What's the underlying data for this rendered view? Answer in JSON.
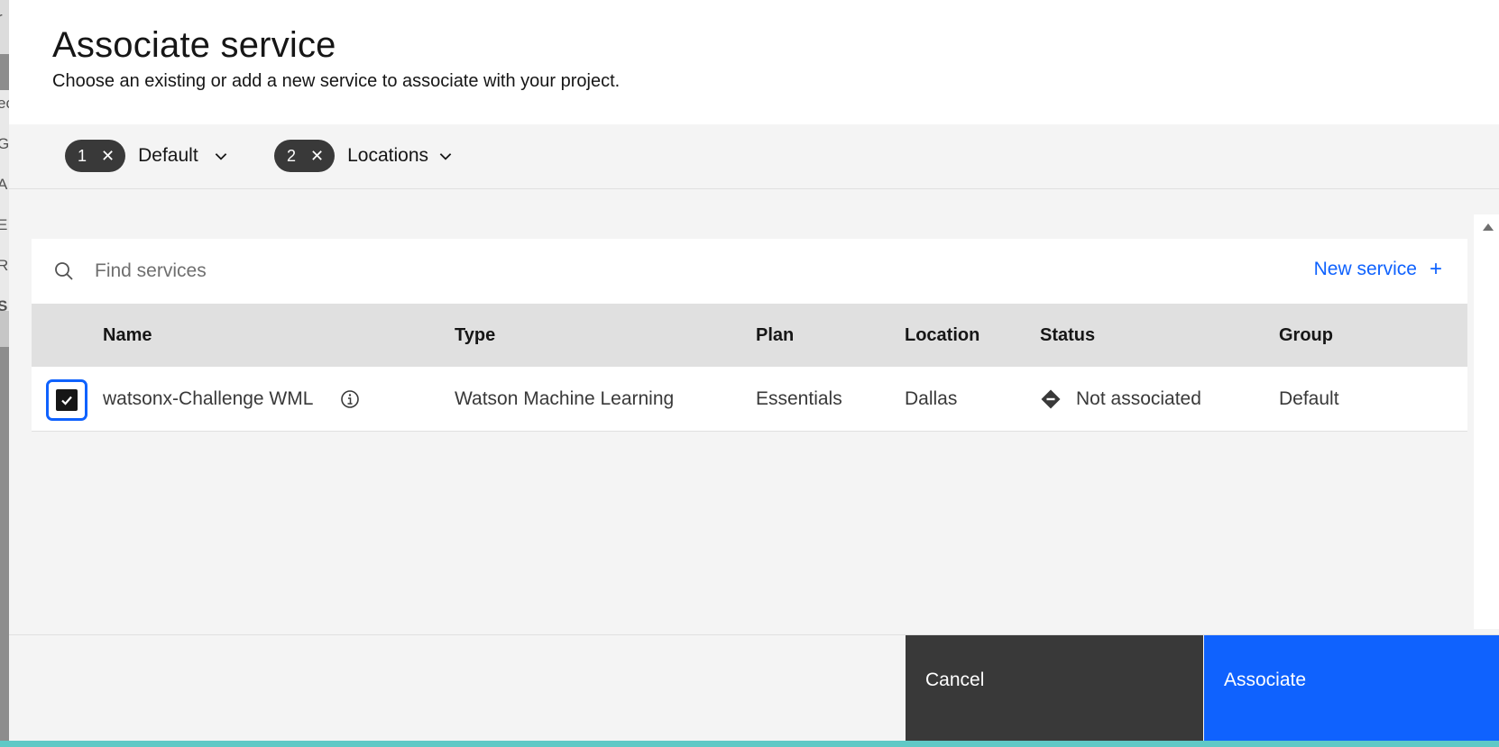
{
  "background_letters": [
    "r",
    "ec",
    "G",
    "A",
    "E",
    "R",
    "S"
  ],
  "modal": {
    "title": "Associate service",
    "subtitle": "Choose an existing or add a new service to associate with your project."
  },
  "filters": [
    {
      "count": "1",
      "label": "Default"
    },
    {
      "count": "2",
      "label": "Locations"
    }
  ],
  "search": {
    "placeholder": "Find services",
    "value": ""
  },
  "new_service": {
    "label": "New service",
    "icon": "plus-icon"
  },
  "table": {
    "columns": [
      "Name",
      "Type",
      "Plan",
      "Location",
      "Status",
      "Group"
    ],
    "rows": [
      {
        "checked": true,
        "name": "watsonx-Challenge WML",
        "type": "Watson Machine Learning",
        "plan": "Essentials",
        "location": "Dallas",
        "status": "Not associated",
        "group": "Default"
      }
    ]
  },
  "footer": {
    "cancel_label": "Cancel",
    "associate_label": "Associate"
  },
  "colors": {
    "primary": "#0f62fe",
    "secondary_button": "#393939",
    "tag": "#393939",
    "header_row": "#e0e0e0"
  }
}
